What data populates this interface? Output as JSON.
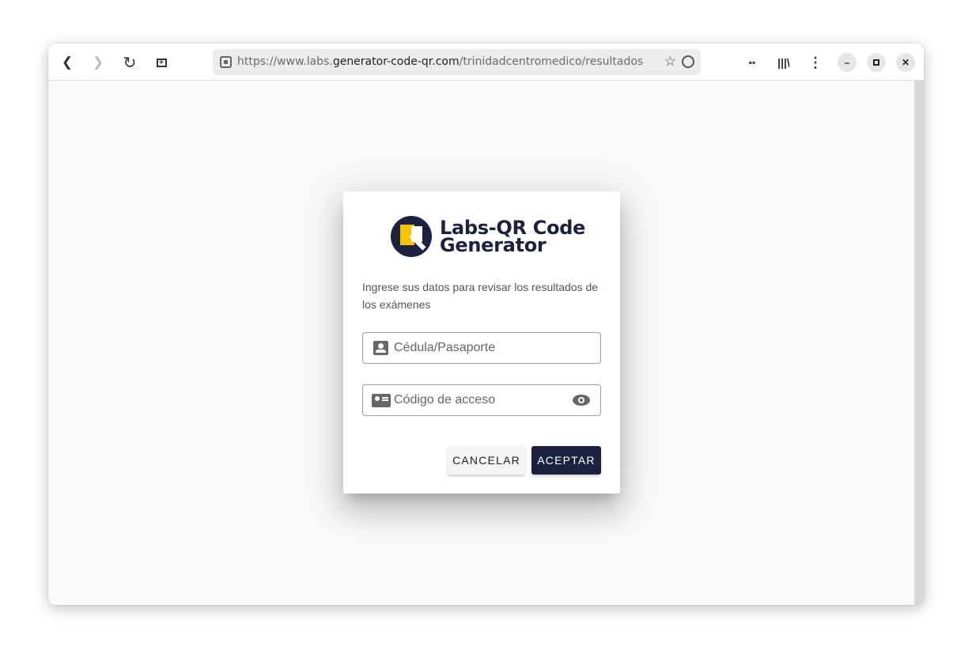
{
  "browser": {
    "url_prefix": "https://www.labs.",
    "url_domain": "generator-code-qr.com",
    "url_path": "/trinidadcentromedico/resultados"
  },
  "dialog": {
    "logo_line1": "Labs-QR Code",
    "logo_line2": "Generator",
    "description": "Ingrese sus datos para revisar los resultados de los exámenes",
    "id_placeholder": "Cédula/Pasaporte",
    "code_placeholder": "Código de acceso",
    "cancel_label": "CANCELAR",
    "accept_label": "ACEPTAR"
  },
  "colors": {
    "brand": "#1c2140",
    "accent": "#f5c400"
  }
}
